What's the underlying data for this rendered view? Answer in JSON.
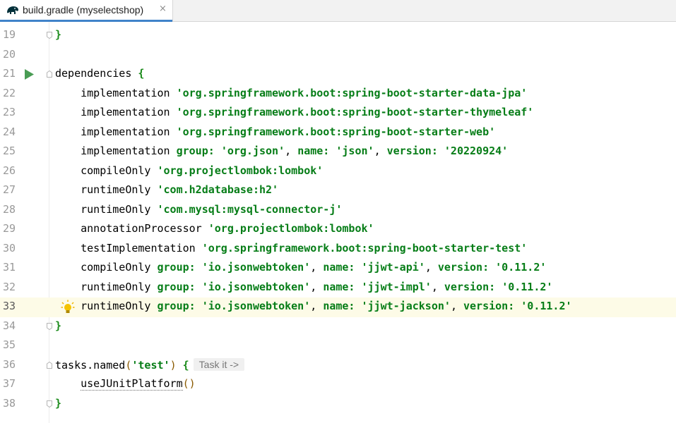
{
  "tab": {
    "title": "build.gradle (myselectshop)",
    "close": "×",
    "icon": "gradle-elephant-icon"
  },
  "lines": [
    {
      "num": "19",
      "text": "}"
    },
    {
      "num": "20",
      "text": ""
    },
    {
      "num": "21",
      "kw": "dependencies",
      "brace": " {"
    },
    {
      "num": "22",
      "fn": "implementation",
      "str": "'org.springframework.boot:spring-boot-starter-data-jpa'"
    },
    {
      "num": "23",
      "fn": "implementation",
      "str": "'org.springframework.boot:spring-boot-starter-thymeleaf'"
    },
    {
      "num": "24",
      "fn": "implementation",
      "str": "'org.springframework.boot:spring-boot-starter-web'"
    },
    {
      "num": "25",
      "fn": "implementation",
      "group": "'org.json'",
      "name": "'json'",
      "version": "'20220924'"
    },
    {
      "num": "26",
      "fn": "compileOnly",
      "str": "'org.projectlombok:lombok'"
    },
    {
      "num": "27",
      "fn": "runtimeOnly",
      "str": "'com.h2database:h2'"
    },
    {
      "num": "28",
      "fn": "runtimeOnly",
      "str": "'com.mysql:mysql-connector-j'"
    },
    {
      "num": "29",
      "fn": "annotationProcessor",
      "str": "'org.projectlombok:lombok'"
    },
    {
      "num": "30",
      "fn": "testImplementation",
      "str": "'org.springframework.boot:spring-boot-starter-test'"
    },
    {
      "num": "31",
      "fn": "compileOnly",
      "group": "'io.jsonwebtoken'",
      "name": "'jjwt-api'",
      "version": "'0.11.2'"
    },
    {
      "num": "32",
      "fn": "runtimeOnly",
      "group": "'io.jsonwebtoken'",
      "name": "'jjwt-impl'",
      "version": "'0.11.2'"
    },
    {
      "num": "33",
      "fn": "runtimeOnly",
      "group": "'io.jsonwebtoken'",
      "name": "'jjwt-jackson'",
      "version": "'0.11.2'"
    },
    {
      "num": "34",
      "text": "}"
    },
    {
      "num": "35",
      "text": ""
    },
    {
      "num": "36",
      "tasks": "tasks.named",
      "arg": "'test'",
      "hint": "Task it ->"
    },
    {
      "num": "37",
      "call": "useJUnitPlatform",
      "parens": "()"
    },
    {
      "num": "38",
      "text": "}"
    }
  ],
  "keywords": {
    "group": "group: ",
    "name": "name: ",
    "version": "version: "
  },
  "colors": {
    "string": "#067d17",
    "current_line": "#fdfbe7",
    "tab_accent": "#4083c9"
  }
}
